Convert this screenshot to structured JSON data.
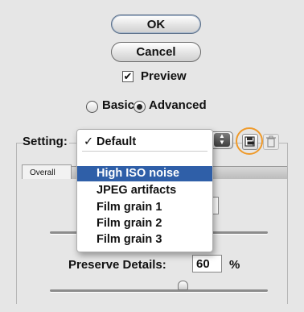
{
  "buttons": {
    "ok_label": "OK",
    "cancel_label": "Cancel"
  },
  "preview": {
    "label": "Preview",
    "checked": true,
    "check_glyph": "✔"
  },
  "mode": {
    "options": [
      {
        "label": "Basic",
        "selected": false
      },
      {
        "label": "Advanced",
        "selected": true
      }
    ]
  },
  "settings": {
    "label": "Setting:",
    "menu": {
      "checked_item": "Default",
      "check_glyph": "✓",
      "items": [
        "High ISO noise",
        "JPEG artifacts",
        "Film grain 1",
        "Film grain 2",
        "Film grain 3"
      ],
      "highlighted_index": 0
    }
  },
  "tabs": [
    {
      "label": "Overall"
    }
  ],
  "preserve_details": {
    "label": "Preserve Details:",
    "value": "60",
    "unit": "%"
  },
  "highlight_color": "#ef9a2a",
  "icons": [
    "save-settings-icon",
    "delete-settings-icon",
    "popup-arrows-icon"
  ]
}
